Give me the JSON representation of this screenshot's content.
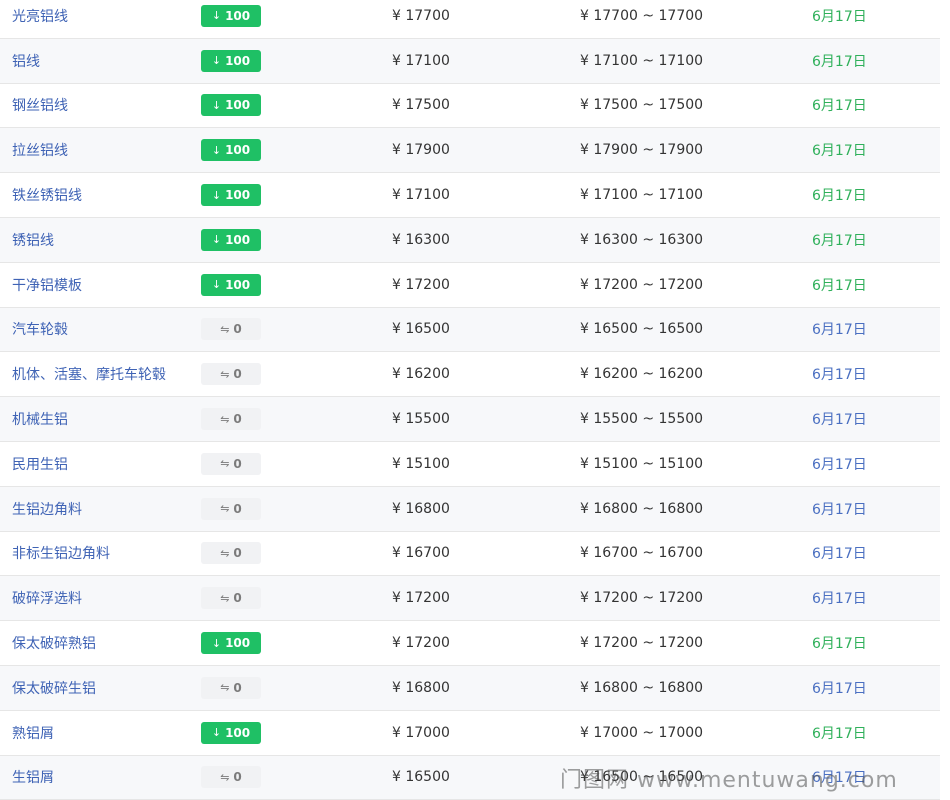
{
  "currency_symbol": "¥",
  "range_separator": "~",
  "colors": {
    "name_link": "#3f63b5",
    "down_badge_bg": "#1fc065",
    "flat_badge_bg": "#f1f2f4",
    "date_green": "#2fb05a",
    "date_blue": "#4a6fc1"
  },
  "icons": {
    "down": "down-arrow-icon",
    "flat": "flat-change-icon"
  },
  "rows": [
    {
      "name": "光亮铝线",
      "change": "100",
      "trend": "down",
      "price": "¥ 17700",
      "range": "¥ 17700 ~ 17700",
      "date": "6月17日",
      "date_color": "green"
    },
    {
      "name": "铝线",
      "change": "100",
      "trend": "down",
      "price": "¥ 17100",
      "range": "¥ 17100 ~ 17100",
      "date": "6月17日",
      "date_color": "green"
    },
    {
      "name": "钢丝铝线",
      "change": "100",
      "trend": "down",
      "price": "¥ 17500",
      "range": "¥ 17500 ~ 17500",
      "date": "6月17日",
      "date_color": "green"
    },
    {
      "name": "拉丝铝线",
      "change": "100",
      "trend": "down",
      "price": "¥ 17900",
      "range": "¥ 17900 ~ 17900",
      "date": "6月17日",
      "date_color": "green"
    },
    {
      "name": "铁丝锈铝线",
      "change": "100",
      "trend": "down",
      "price": "¥ 17100",
      "range": "¥ 17100 ~ 17100",
      "date": "6月17日",
      "date_color": "green"
    },
    {
      "name": "锈铝线",
      "change": "100",
      "trend": "down",
      "price": "¥ 16300",
      "range": "¥ 16300 ~ 16300",
      "date": "6月17日",
      "date_color": "green"
    },
    {
      "name": "干净铝模板",
      "change": "100",
      "trend": "down",
      "price": "¥ 17200",
      "range": "¥ 17200 ~ 17200",
      "date": "6月17日",
      "date_color": "green"
    },
    {
      "name": "汽车轮毂",
      "change": "0",
      "trend": "flat",
      "price": "¥ 16500",
      "range": "¥ 16500 ~ 16500",
      "date": "6月17日",
      "date_color": "blue"
    },
    {
      "name": "机体、活塞、摩托车轮毂",
      "change": "0",
      "trend": "flat",
      "price": "¥ 16200",
      "range": "¥ 16200 ~ 16200",
      "date": "6月17日",
      "date_color": "blue"
    },
    {
      "name": "机械生铝",
      "change": "0",
      "trend": "flat",
      "price": "¥ 15500",
      "range": "¥ 15500 ~ 15500",
      "date": "6月17日",
      "date_color": "blue"
    },
    {
      "name": "民用生铝",
      "change": "0",
      "trend": "flat",
      "price": "¥ 15100",
      "range": "¥ 15100 ~ 15100",
      "date": "6月17日",
      "date_color": "blue"
    },
    {
      "name": "生铝边角料",
      "change": "0",
      "trend": "flat",
      "price": "¥ 16800",
      "range": "¥ 16800 ~ 16800",
      "date": "6月17日",
      "date_color": "blue"
    },
    {
      "name": "非标生铝边角料",
      "change": "0",
      "trend": "flat",
      "price": "¥ 16700",
      "range": "¥ 16700 ~ 16700",
      "date": "6月17日",
      "date_color": "blue"
    },
    {
      "name": "破碎浮选料",
      "change": "0",
      "trend": "flat",
      "price": "¥ 17200",
      "range": "¥ 17200 ~ 17200",
      "date": "6月17日",
      "date_color": "blue"
    },
    {
      "name": "保太破碎熟铝",
      "change": "100",
      "trend": "down",
      "price": "¥ 17200",
      "range": "¥ 17200 ~ 17200",
      "date": "6月17日",
      "date_color": "green"
    },
    {
      "name": "保太破碎生铝",
      "change": "0",
      "trend": "flat",
      "price": "¥ 16800",
      "range": "¥ 16800 ~ 16800",
      "date": "6月17日",
      "date_color": "blue"
    },
    {
      "name": "熟铝屑",
      "change": "100",
      "trend": "down",
      "price": "¥ 17000",
      "range": "¥ 17000 ~ 17000",
      "date": "6月17日",
      "date_color": "green"
    },
    {
      "name": "生铝屑",
      "change": "0",
      "trend": "flat",
      "price": "¥ 16500",
      "range": "¥ 16500 ~ 16500",
      "date": "6月17日",
      "date_color": "blue"
    }
  ],
  "watermark": "门图网 www.mentuwang.com"
}
